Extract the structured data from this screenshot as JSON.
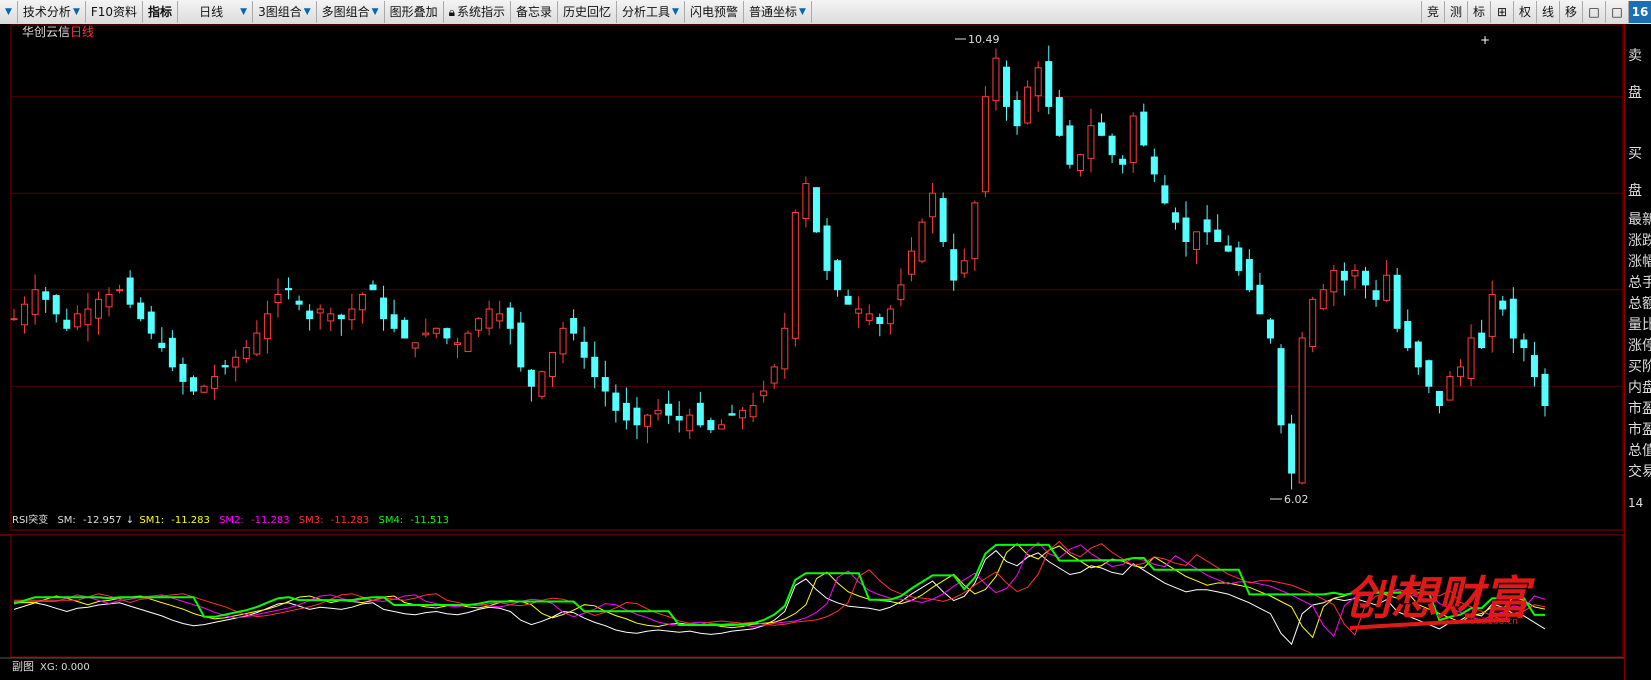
{
  "toolbar": {
    "items": [
      {
        "label": "技术分析",
        "dd": true
      },
      {
        "label": "F10资料",
        "dd": false
      },
      {
        "label": "指标",
        "dd": false,
        "bold": true
      },
      {
        "label": "日线",
        "dd": true
      },
      {
        "label": "3图组合",
        "dd": true
      },
      {
        "label": "多图组合",
        "dd": true
      },
      {
        "label": "图形叠加",
        "dd": false
      },
      {
        "label": "系统指示",
        "dd": false
      },
      {
        "label": "备忘录",
        "dd": false
      },
      {
        "label": "历史回忆",
        "dd": false
      },
      {
        "label": "分析工具",
        "dd": true
      },
      {
        "label": "闪电预警",
        "dd": false
      },
      {
        "label": "普通坐标",
        "dd": true
      }
    ],
    "right_buttons": [
      "竞",
      "测",
      "标",
      "⊞",
      "权",
      "线",
      "移",
      "□",
      "□"
    ],
    "corner": "16"
  },
  "stock": {
    "name": "华创云信",
    "period": "日线"
  },
  "main_chart": {
    "high_label": "10.49",
    "low_label": "6.02",
    "cursor": "+"
  },
  "indicator": {
    "name": "RSI突变",
    "sm_label": "SM:",
    "sm_value": "-12.957",
    "sm1_label": "SM1:",
    "sm1_value": "-11.283",
    "sm2_label": "SM2:",
    "sm2_value": "-11.283",
    "sm3_label": "SM3:",
    "sm3_value": "-11.283",
    "sm4_label": "SM4:",
    "sm4_value": "-11.513",
    "colors": {
      "sm": "#ffffff",
      "sm1": "#ffff00",
      "sm2": "#ff00ff",
      "sm3": "#ff3030",
      "sm4": "#00ff00"
    }
  },
  "footer": {
    "label": "副图",
    "xg": "XG: 0.000"
  },
  "side_panel": [
    "卖",
    "盘",
    "买",
    "盘",
    "最新",
    "涨跌",
    "涨幅",
    "总手",
    "总额",
    "量比",
    "涨停",
    "买阶",
    "内盘",
    "市盈",
    "市盈",
    "总值",
    "交易"
  ],
  "side_number": "14",
  "watermark": {
    "text": "创想财富",
    "url": "995168.cn"
  },
  "chart_data": {
    "type": "candlestick",
    "title": "华创云信 日线",
    "ylim": [
      5.8,
      10.65
    ],
    "y_gridlines": [
      7.0,
      8.0,
      9.0,
      10.0
    ],
    "annotations": [
      {
        "text": "10.49",
        "value": 10.49
      },
      {
        "text": "6.02",
        "value": 6.02
      }
    ],
    "close_series": [
      7.7,
      7.85,
      8.0,
      7.9,
      7.75,
      7.6,
      7.75,
      7.8,
      7.9,
      7.95,
      8.0,
      7.85,
      7.7,
      7.55,
      7.4,
      7.2,
      7.05,
      6.95,
      7.0,
      7.1,
      7.2,
      7.3,
      7.4,
      7.55,
      7.75,
      7.95,
      8.0,
      7.85,
      7.7,
      7.8,
      7.75,
      7.7,
      7.8,
      7.95,
      8.0,
      7.7,
      7.6,
      7.5,
      7.45,
      7.55,
      7.6,
      7.5,
      7.45,
      7.55,
      7.7,
      7.8,
      7.75,
      7.6,
      7.2,
      7.0,
      7.15,
      7.35,
      7.6,
      7.55,
      7.3,
      7.1,
      6.95,
      6.75,
      6.65,
      6.6,
      6.7,
      6.75,
      6.7,
      6.65,
      6.7,
      6.6,
      6.55,
      6.6,
      6.7,
      6.75,
      6.8,
      6.95,
      7.2,
      7.6,
      8.8,
      9.1,
      8.6,
      8.2,
      8.0,
      7.85,
      7.8,
      7.75,
      7.65,
      7.8,
      8.05,
      8.4,
      8.7,
      9.0,
      8.5,
      8.1,
      8.3,
      8.9,
      10.0,
      10.4,
      9.9,
      9.7,
      10.1,
      10.3,
      9.9,
      9.6,
      9.3,
      9.4,
      9.7,
      9.6,
      9.4,
      9.3,
      9.8,
      9.5,
      9.2,
      8.9,
      8.7,
      8.5,
      8.6,
      8.6,
      8.5,
      8.4,
      8.2,
      8.0,
      7.75,
      7.5,
      6.6,
      6.1,
      7.5,
      7.9,
      8.0,
      8.2,
      8.1,
      8.2,
      8.05,
      7.9,
      8.15,
      7.6,
      7.4,
      7.2,
      7.0,
      6.8,
      7.1,
      7.2,
      7.5,
      7.4,
      7.95,
      7.8,
      7.5,
      7.4,
      7.1,
      6.8
    ],
    "indicator_ylim": [
      -25,
      5
    ],
    "indicator_series": [
      {
        "name": "SM",
        "color": "#ffffff"
      },
      {
        "name": "SM1",
        "color": "#ffff00"
      },
      {
        "name": "SM2",
        "color": "#ff00ff"
      },
      {
        "name": "SM3",
        "color": "#ff3030"
      },
      {
        "name": "SM4",
        "color": "#00ff00"
      }
    ]
  }
}
